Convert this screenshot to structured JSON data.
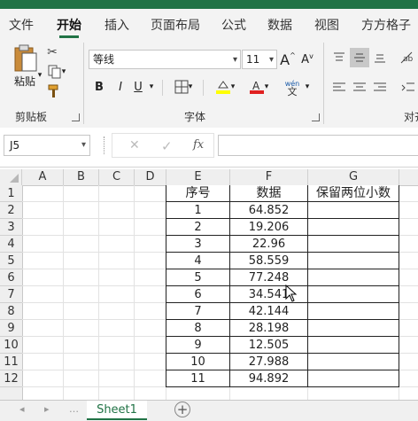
{
  "ribbon_tabs": [
    "文件",
    "开始",
    "插入",
    "页面布局",
    "公式",
    "数据",
    "视图",
    "方方格子"
  ],
  "active_tab": "开始",
  "clipboard": {
    "paste_label": "粘贴",
    "group_label": "剪贴板"
  },
  "font": {
    "name": "等线",
    "size": "11",
    "group_label": "字体",
    "bold": "B",
    "italic": "I",
    "underline": "U",
    "grow": "A",
    "shrink": "A",
    "phonetic_top": "wén",
    "phonetic_bottom": "文"
  },
  "alignment": {
    "group_label_partial": "对齐"
  },
  "formula_bar": {
    "name_box": "J5",
    "cancel": "✕",
    "enter": "✓",
    "fx": "fx",
    "value": ""
  },
  "columns": [
    "A",
    "B",
    "C",
    "D",
    "E",
    "F",
    "G"
  ],
  "rows": [
    "1",
    "2",
    "3",
    "4",
    "5",
    "6",
    "7",
    "8",
    "9",
    "10",
    "11",
    "12"
  ],
  "table": {
    "headers": [
      "序号",
      "数据",
      "保留两位小数"
    ],
    "rows": [
      [
        "1",
        "64.852",
        ""
      ],
      [
        "2",
        "19.206",
        ""
      ],
      [
        "3",
        "22.96",
        ""
      ],
      [
        "4",
        "58.559",
        ""
      ],
      [
        "5",
        "77.248",
        ""
      ],
      [
        "6",
        "34.541",
        ""
      ],
      [
        "7",
        "42.144",
        ""
      ],
      [
        "8",
        "28.198",
        ""
      ],
      [
        "9",
        "12.505",
        ""
      ],
      [
        "10",
        "27.988",
        ""
      ],
      [
        "11",
        "94.892",
        ""
      ]
    ]
  },
  "sheet_tabs": [
    "Sheet1"
  ],
  "accent_color": "#217346",
  "font_color_bar": "#e02020",
  "highlight_color_bar": "#ffff00"
}
